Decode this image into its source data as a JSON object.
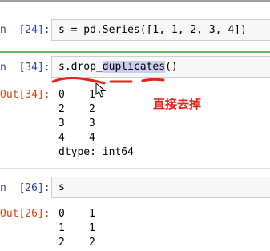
{
  "cells": [
    {
      "in_prompt": "n  [24]:",
      "code": {
        "pre": "s = pd.Series([1, 1, 2, 3, 4])"
      }
    },
    {
      "in_prompt": "n  [34]:",
      "code": {
        "pre": "s.drop_",
        "highlight": "duplicates",
        "post": "()"
      },
      "out_prompt": "Out[34]:",
      "output": {
        "rows": [
          {
            "index": "0",
            "value": "1"
          },
          {
            "index": "2",
            "value": "2"
          },
          {
            "index": "3",
            "value": "3"
          },
          {
            "index": "4",
            "value": "4"
          }
        ],
        "dtype": "dtype: int64"
      },
      "annotation": "直接去掉"
    },
    {
      "in_prompt": "n  [26]:",
      "code": {
        "pre": "s"
      },
      "out_prompt": "Out[26]:",
      "output": {
        "rows": [
          {
            "index": "0",
            "value": "1"
          },
          {
            "index": "1",
            "value": "1"
          },
          {
            "index": "2",
            "value": "2"
          }
        ]
      }
    }
  ],
  "colors": {
    "in_prompt": "#303f9f",
    "out_prompt": "#d84315",
    "annotation": "#e3221a",
    "selected_border": "#66bb6a"
  }
}
